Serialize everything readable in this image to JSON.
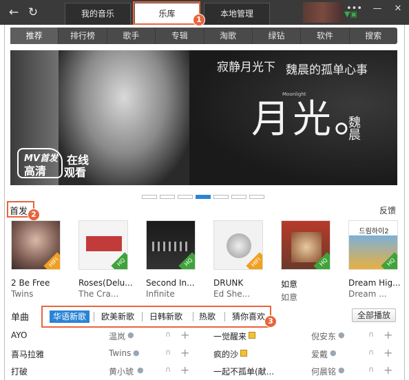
{
  "topbar": {
    "tabs": [
      "我的音乐",
      "乐库",
      "本地管理"
    ],
    "active_tab": "乐库",
    "menu_label": "•••",
    "minimize": "—",
    "close": "✕"
  },
  "markers": [
    "1",
    "2",
    "3"
  ],
  "nav": [
    "推荐",
    "排行榜",
    "歌手",
    "专辑",
    "淘歌",
    "绿钻",
    "软件",
    "搜索"
  ],
  "banner": {
    "title1": "寂静月光下",
    "title2": "魏晨的孤单心事",
    "big_text": "月光。",
    "sign": "魏晨",
    "moonlight": "Moonlight",
    "mv_label": "MV首发",
    "hd_label": "高清",
    "online1": "在线",
    "online2": "观看",
    "slide_count": 7,
    "active_slide": 4
  },
  "section": {
    "title": "首发",
    "feedback": "反馈"
  },
  "albums": [
    {
      "title": "2 Be Free",
      "artist": "Twins",
      "badge": "HIFI"
    },
    {
      "title": "Roses(Delu...",
      "artist": "The Cra...",
      "badge": "HQ"
    },
    {
      "title": "Second In...",
      "artist": "Infinite",
      "badge": "HQ"
    },
    {
      "title": "DRUNK",
      "artist": "Ed She...",
      "badge": "HIFI"
    },
    {
      "title": "如意",
      "artist": "如意",
      "badge": "HQ"
    },
    {
      "title": "Dream Hig...",
      "artist": "Dream ...",
      "badge": "HQ"
    }
  ],
  "album_cover_text": {
    "cover6": "드림하이2"
  },
  "singles": {
    "label": "单曲",
    "tabs": [
      "华语新歌",
      "欧美新歌",
      "日韩新歌",
      "热歌",
      "猜你喜欢"
    ],
    "active_tab": "华语新歌",
    "play_all": "全部播放",
    "rows": [
      {
        "left_song": "AYO",
        "left_artist": "温岚",
        "right_song": "一觉醒来",
        "right_artist": "倪安东"
      },
      {
        "left_song": "喜马拉雅",
        "left_artist": "Twins",
        "right_song": "疯的沙",
        "right_artist": "爱戴"
      },
      {
        "left_song": "打破",
        "left_artist": "黄小琥",
        "right_song": "一起不孤单(献...",
        "right_artist": "何晨铭"
      }
    ]
  }
}
